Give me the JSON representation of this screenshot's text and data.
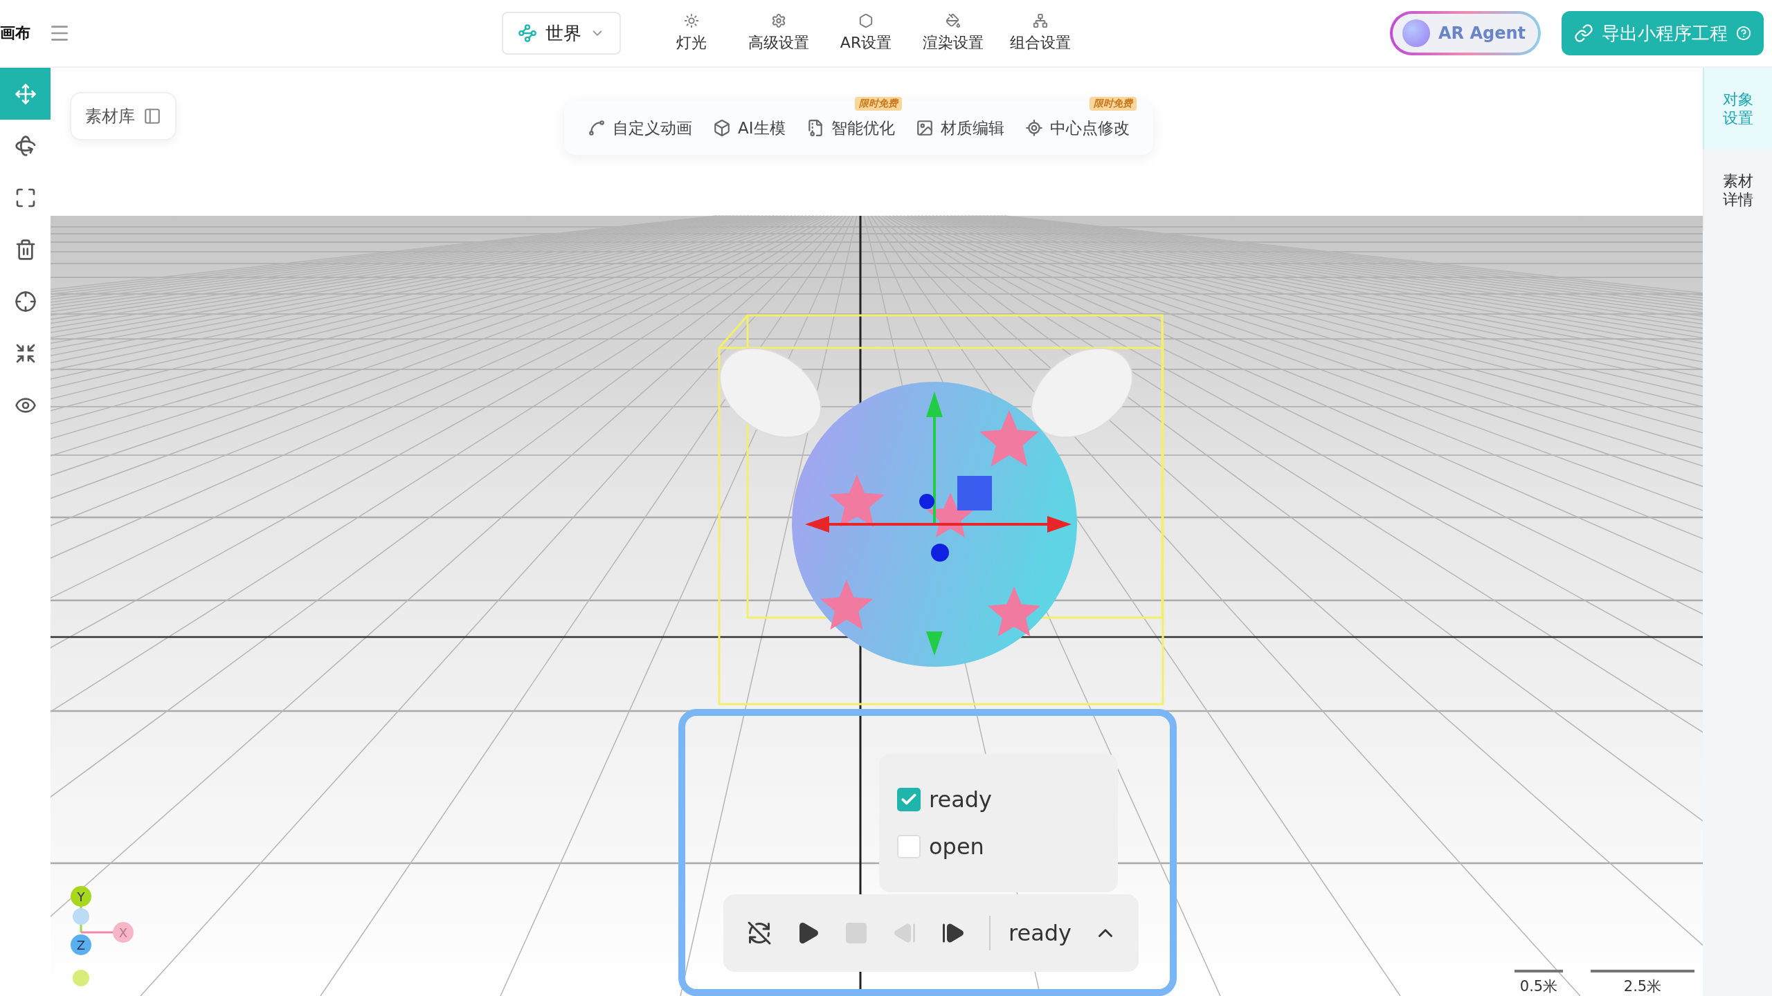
{
  "app": {
    "title": "画布"
  },
  "mode_select": {
    "value": "世界"
  },
  "top_tools": [
    {
      "kind": "light",
      "label": "灯光"
    },
    {
      "kind": "advanced",
      "label": "高级设置"
    },
    {
      "kind": "ar",
      "label": "AR设置"
    },
    {
      "kind": "render",
      "label": "渲染设置"
    },
    {
      "kind": "group",
      "label": "组合设置"
    }
  ],
  "ar_agent": {
    "label": "AR Agent"
  },
  "export_button": {
    "label": "导出小程序工程"
  },
  "left_tools": [
    {
      "kind": "move",
      "selected": true
    },
    {
      "kind": "rotate",
      "selected": false
    },
    {
      "kind": "scale",
      "selected": false
    },
    {
      "kind": "delete",
      "selected": false
    },
    {
      "kind": "focus",
      "selected": false
    },
    {
      "kind": "shrink",
      "selected": false
    },
    {
      "kind": "visibility",
      "selected": false
    }
  ],
  "library_button": {
    "label": "素材库"
  },
  "feature_toolbar": [
    {
      "kind": "animation",
      "label": "自定义动画"
    },
    {
      "kind": "ai-model",
      "label": "AI生模"
    },
    {
      "kind": "optimize",
      "label": "智能优化",
      "badge": "限时免费"
    },
    {
      "kind": "material",
      "label": "材质编辑"
    },
    {
      "kind": "pivot",
      "label": "中心点修改",
      "badge": "限时免费"
    }
  ],
  "right_tabs": [
    {
      "label": "对象设置",
      "selected": true
    },
    {
      "label": "素材详情",
      "selected": false
    }
  ],
  "animation": {
    "states": [
      {
        "label": "ready",
        "checked": true
      },
      {
        "label": "open",
        "checked": false
      }
    ],
    "controls": [
      {
        "kind": "loop-off",
        "disabled": false
      },
      {
        "kind": "play",
        "disabled": false
      },
      {
        "kind": "stop",
        "disabled": true
      },
      {
        "kind": "step-back",
        "disabled": true
      },
      {
        "kind": "step-forward",
        "disabled": false
      }
    ],
    "current": "ready"
  },
  "axis_gizmo": {
    "y": "Y",
    "z": "Z",
    "x": "X"
  },
  "scale_bar": [
    {
      "label": "0.5米"
    },
    {
      "label": "2.5米"
    }
  ]
}
